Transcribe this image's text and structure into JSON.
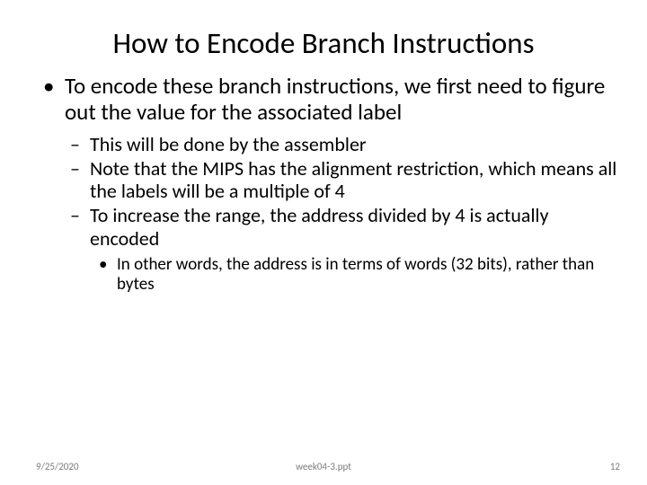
{
  "title": "How to Encode Branch Instructions",
  "bullets": {
    "l1_0": "To encode these branch instructions, we first need to figure out the value for the associated label",
    "l2_0": "This will be done by the assembler",
    "l2_1": "Note that the MIPS has the alignment restriction, which means all the labels will be a multiple of 4",
    "l2_2": "To increase the range, the address divided by 4 is actually encoded",
    "l3_0": "In other words, the address is in terms of words (32 bits), rather than bytes"
  },
  "footer": {
    "date": "9/25/2020",
    "file": "week04-3.ppt",
    "page": "12"
  }
}
